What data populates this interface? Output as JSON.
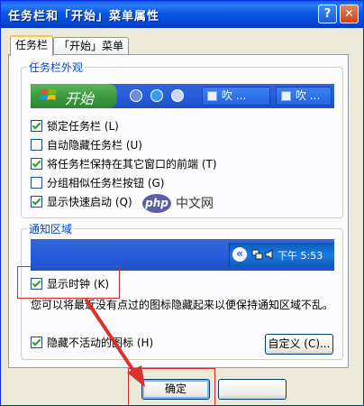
{
  "window": {
    "title": "任务栏和「开始」菜单属性",
    "help_label": "?",
    "close_label": "✕"
  },
  "tabs": [
    {
      "label": "任务栏",
      "active": true
    },
    {
      "label": "「开始」菜单",
      "active": false
    }
  ],
  "appearance": {
    "group_label": "任务栏外观",
    "start_label": "开始",
    "task_buttons": [
      "吹 ...",
      "吹 ..."
    ],
    "options": [
      {
        "label": "锁定任务栏 (L)",
        "checked": true
      },
      {
        "label": "自动隐藏任务栏 (U)",
        "checked": false
      },
      {
        "label": "将任务栏保持在其它窗口的前端 (T)",
        "checked": true
      },
      {
        "label": "分组相似任务栏按钮 (G)",
        "checked": false
      },
      {
        "label": "显示快速启动 (Q)",
        "checked": true
      }
    ]
  },
  "notification": {
    "group_label": "通知区域",
    "chevron": "«",
    "clock": "下午 5:53",
    "show_clock": {
      "label": "显示时钟 (K)",
      "checked": true
    },
    "description": "您可以将最近没有点过的图标隐藏起来以便保持通知区域不乱。",
    "hide_inactive": {
      "label": "隐藏不活动的图标 (H)",
      "checked": true
    },
    "customize_label": "自定义 (C)..."
  },
  "buttons": {
    "ok": "确定",
    "cancel": ""
  },
  "watermark": {
    "badge": "php",
    "text": "中文网"
  },
  "colors": {
    "accent": "#0046D5",
    "highlight": "#D02A2A",
    "title_bar": "#0A57E4"
  }
}
